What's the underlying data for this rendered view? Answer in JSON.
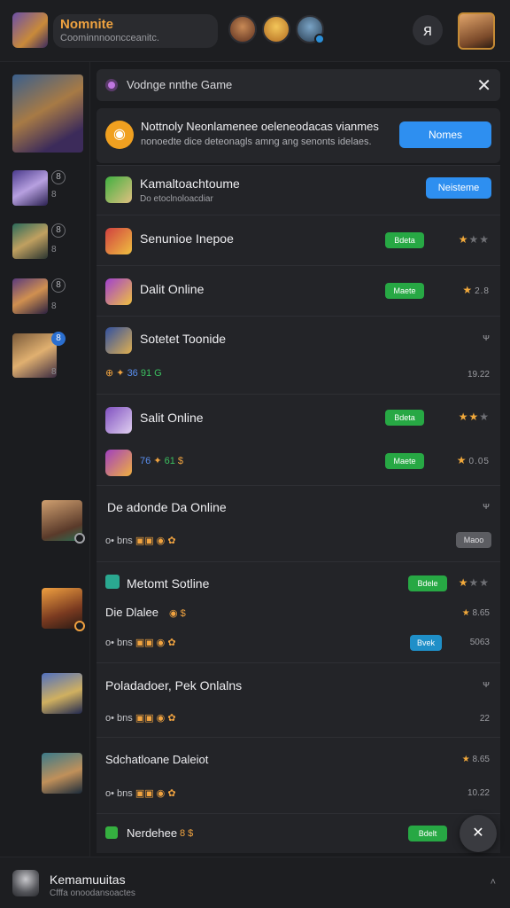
{
  "header": {
    "app_title": "Nomnite",
    "app_subtitle": "Coominnnooncceanitc.",
    "close_symbol": "ᴙ"
  },
  "rail": {
    "items": [
      {
        "badge": "8",
        "sub": "8"
      },
      {
        "badge": "8",
        "sub": "8"
      },
      {
        "badge": "8",
        "sub": "8"
      },
      {
        "badge": "8",
        "sub": "8"
      }
    ]
  },
  "notice": {
    "text": "Vodnge nnthe Game",
    "close": "✕"
  },
  "promo": {
    "line1": "Nottnoly Neonlamenee oeleneodacas vianmes",
    "line2": "nonoedte dice deteonagls amng ang senonts idelaes.",
    "button": "Nomes"
  },
  "rows": [
    {
      "label": "Kamaltoachtoume",
      "sublabel": "Do etoclnoloacdiar",
      "action": "Neisteme"
    },
    {
      "label": "Senunioe Inepoe",
      "pill": "Bdeta",
      "stars_on": 1,
      "stars_off": 2
    },
    {
      "label": "Dalit Online",
      "pill": "Maete",
      "stars_on": 1,
      "stars_off": 0,
      "num": "2.8"
    },
    {
      "label": "Sotetet Toonide",
      "meta_blue": "36",
      "meta_green": "91 G",
      "right_top": "ᴪ",
      "right_bottom": "19.22"
    },
    {
      "label": "Salit Online",
      "pill": "Bdeta",
      "stars_on": 2,
      "stars_off": 1
    },
    {
      "sub_meta_blue": "76",
      "sub_meta_green": "61",
      "sub_meta_gold": "$",
      "pill": "Maete",
      "stars_on": 1,
      "stars_off": 0,
      "num": "0.05"
    },
    {
      "label": "De adonde Da Online",
      "meta": "o• bns",
      "right_top": "ᴪ",
      "gray_pill": "Maoo"
    },
    {
      "label": "Metomt Sotline",
      "pill": "Bdele",
      "stars_on": 1,
      "stars_off": 2,
      "sub_label": "Die Dlalee",
      "sub_gold": "$",
      "sub_right": "8.65",
      "meta": "o• bns",
      "blue_pill": "Bvek",
      "meta_right": "5063"
    },
    {
      "label": "Poladadoer, Pek Onlalns",
      "right_top": "ᴪ",
      "meta": "o• bns",
      "meta_right": "22"
    },
    {
      "label": "Sdchatloane Daleiot",
      "right_top": "8.65",
      "meta": "o• bns",
      "meta_right": "10.22"
    },
    {
      "label": "Nerdehee",
      "gold": "8 $",
      "pill": "Bdelt"
    }
  ],
  "fab": "✕",
  "bottom": {
    "title": "Kemamuuitas",
    "subtitle": "Cfffa    onoodansoactes",
    "chev": "˄"
  }
}
